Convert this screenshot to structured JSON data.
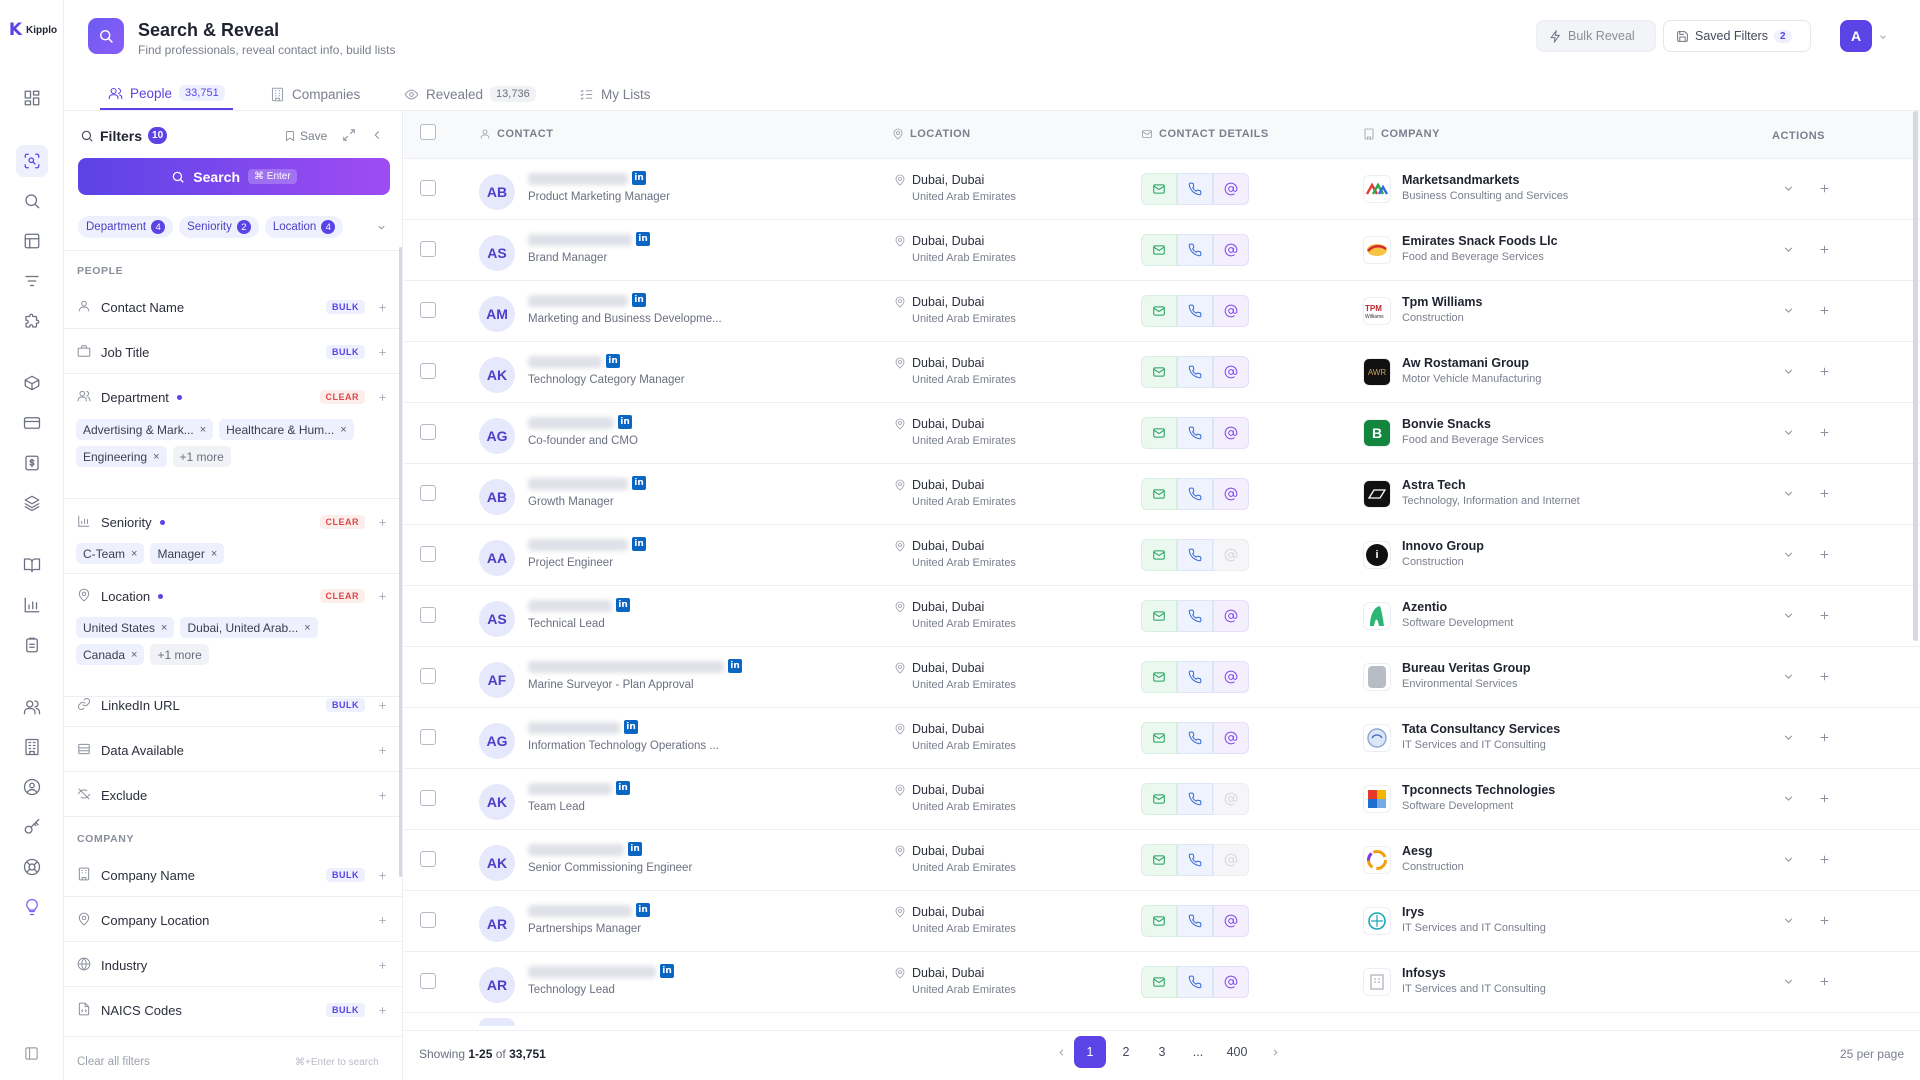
{
  "app": {
    "name": "Kipplo"
  },
  "header": {
    "title": "Search & Reveal",
    "subtitle": "Find professionals, reveal contact info, build lists",
    "bulk_reveal": "Bulk Reveal",
    "saved_filters": "Saved Filters",
    "saved_count": "2",
    "avatar": "A"
  },
  "tabs": [
    {
      "label": "People",
      "count": "33,751",
      "icon": "users-icon"
    },
    {
      "label": "Companies",
      "count": "",
      "icon": "building-icon"
    },
    {
      "label": "Revealed",
      "count": "13,736",
      "icon": "eye-icon"
    },
    {
      "label": "My Lists",
      "count": "",
      "icon": "list-check-icon"
    }
  ],
  "filters": {
    "title": "Filters",
    "count": "10",
    "save": "Save",
    "search_button": "Search",
    "search_kbd": "⌘ Enter",
    "summary": [
      {
        "label": "Department",
        "count": "4"
      },
      {
        "label": "Seniority",
        "count": "2"
      },
      {
        "label": "Location",
        "count": "4"
      }
    ],
    "people_section": "PEOPLE",
    "company_section": "COMPANY",
    "bulk": "BULK",
    "clear": "CLEAR",
    "people": [
      {
        "label": "Contact Name"
      },
      {
        "label": "Job Title"
      },
      {
        "label": "Department"
      },
      {
        "label": "Seniority"
      },
      {
        "label": "Location"
      },
      {
        "label": "LinkedIn URL"
      },
      {
        "label": "Data Available"
      },
      {
        "label": "Exclude"
      }
    ],
    "company": [
      {
        "label": "Company Name"
      },
      {
        "label": "Company Location"
      },
      {
        "label": "Industry"
      },
      {
        "label": "NAICS Codes"
      }
    ],
    "department_values": [
      "Advertising & Mark...",
      "Healthcare & Hum...",
      "Engineering",
      "+1 more"
    ],
    "seniority_values": [
      "C-Team",
      "Manager"
    ],
    "location_values": [
      "United States",
      "Dubai, United Arab...",
      "Canada",
      "+1 more"
    ],
    "clear_all": "Clear all filters",
    "hint": "⌘+Enter to search"
  },
  "table": {
    "headers": {
      "contact": "CONTACT",
      "location": "LOCATION",
      "details": "CONTACT DETAILS",
      "company": "COMPANY",
      "actions": "ACTIONS"
    },
    "rows": [
      {
        "initials": "AB",
        "title": "Product Marketing Manager",
        "city": "Dubai, Dubai",
        "country": "United Arab Emirates",
        "company": "Marketsandmarkets",
        "industry": "Business Consulting and Services",
        "at": true
      },
      {
        "initials": "AS",
        "title": "Brand Manager",
        "city": "Dubai, Dubai",
        "country": "United Arab Emirates",
        "company": "Emirates Snack Foods Llc",
        "industry": "Food and Beverage Services",
        "at": true
      },
      {
        "initials": "AM",
        "title": "Marketing and Business Developme...",
        "city": "Dubai, Dubai",
        "country": "United Arab Emirates",
        "company": "Tpm Williams",
        "industry": "Construction",
        "at": true
      },
      {
        "initials": "AK",
        "title": "Technology Category Manager",
        "city": "Dubai, Dubai",
        "country": "United Arab Emirates",
        "company": "Aw Rostamani Group",
        "industry": "Motor Vehicle Manufacturing",
        "at": true
      },
      {
        "initials": "AG",
        "title": "Co-founder and CMO",
        "city": "Dubai, Dubai",
        "country": "United Arab Emirates",
        "company": "Bonvie Snacks",
        "industry": "Food and Beverage Services",
        "at": true
      },
      {
        "initials": "AB",
        "title": "Growth Manager",
        "city": "Dubai, Dubai",
        "country": "United Arab Emirates",
        "company": "Astra Tech",
        "industry": "Technology, Information and Internet",
        "at": true
      },
      {
        "initials": "AA",
        "title": "Project Engineer",
        "city": "Dubai, Dubai",
        "country": "United Arab Emirates",
        "company": "Innovo Group",
        "industry": "Construction",
        "at": false
      },
      {
        "initials": "AS",
        "title": "Technical Lead",
        "city": "Dubai, Dubai",
        "country": "United Arab Emirates",
        "company": "Azentio",
        "industry": "Software Development",
        "at": true
      },
      {
        "initials": "AF",
        "title": "Marine Surveyor - Plan Approval",
        "city": "Dubai, Dubai",
        "country": "United Arab Emirates",
        "company": "Bureau Veritas Group",
        "industry": "Environmental Services",
        "at": true
      },
      {
        "initials": "AG",
        "title": "Information Technology Operations ...",
        "city": "Dubai, Dubai",
        "country": "United Arab Emirates",
        "company": "Tata Consultancy Services",
        "industry": "IT Services and IT Consulting",
        "at": true
      },
      {
        "initials": "AK",
        "title": "Team Lead",
        "city": "Dubai, Dubai",
        "country": "United Arab Emirates",
        "company": "Tpconnects Technologies",
        "industry": "Software Development",
        "at": false
      },
      {
        "initials": "AK",
        "title": "Senior Commissioning Engineer",
        "city": "Dubai, Dubai",
        "country": "United Arab Emirates",
        "company": "Aesg",
        "industry": "Construction",
        "at": false
      },
      {
        "initials": "AR",
        "title": "Partnerships Manager",
        "city": "Dubai, Dubai",
        "country": "United Arab Emirates",
        "company": "Irys",
        "industry": "IT Services and IT Consulting",
        "at": true
      },
      {
        "initials": "AR",
        "title": "Technology Lead",
        "city": "Dubai, Dubai",
        "country": "United Arab Emirates",
        "company": "Infosys",
        "industry": "IT Services and IT Consulting",
        "at": true
      }
    ]
  },
  "footer": {
    "showing_prefix": "Showing ",
    "range": "1-25",
    "of": " of ",
    "total": "33,751",
    "pages": [
      "1",
      "2",
      "3",
      "...",
      "400"
    ],
    "per_page": "25 per page"
  }
}
